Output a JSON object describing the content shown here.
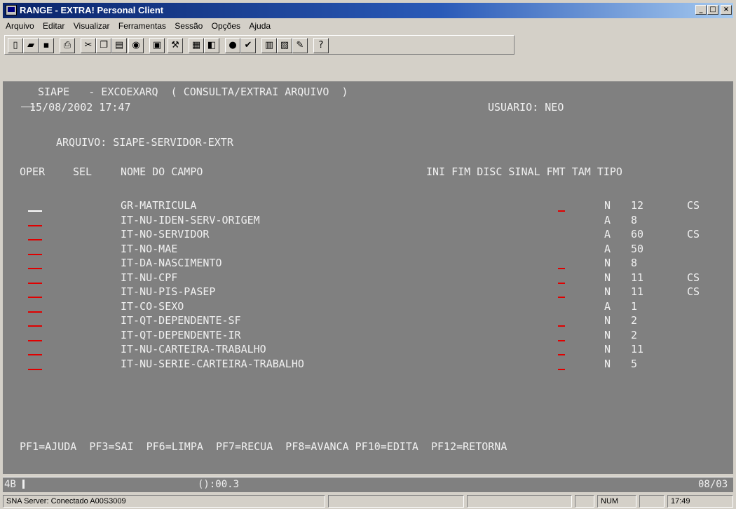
{
  "window": {
    "title": "RANGE - EXTRA! Personal Client"
  },
  "menu": [
    "Arquivo",
    "Editar",
    "Visualizar",
    "Ferramentas",
    "Sessão",
    "Opções",
    "Ajuda"
  ],
  "toolbar_icons": [
    "new-icon",
    "open-icon",
    "save-icon",
    "print-icon",
    "cut-icon",
    "copy-icon",
    "paste-icon",
    "keyboard-icon",
    "transfer-icon",
    "tools-icon",
    "macro-icon",
    "record-icon",
    "play-icon",
    "settings-icon",
    "chart-icon",
    "report-icon",
    "edit-icon",
    "help-icon"
  ],
  "terminal": {
    "header_line1": "SIAPE   - EXCOEXARQ  ( CONSULTA/EXTRAI ARQUIVO  )",
    "datetime": "15/08/2002 17:47",
    "user": "USUARIO: NEO",
    "arquivo": "ARQUIVO: SIAPE-SERVIDOR-EXTR",
    "columns": {
      "oper": "OPER",
      "sel": "SEL",
      "nome": "NOME DO CAMPO",
      "rest": "INI FIM DISC SINAL FMT TAM TIPO"
    },
    "rows": [
      {
        "campo": "GR-MATRICULA",
        "fmt": "N",
        "tam": "12",
        "tipo": "CS",
        "sinal": true
      },
      {
        "campo": "IT-NU-IDEN-SERV-ORIGEM",
        "fmt": "A",
        "tam": "8",
        "tipo": "",
        "sinal": false
      },
      {
        "campo": "IT-NO-SERVIDOR",
        "fmt": "A",
        "tam": "60",
        "tipo": "CS",
        "sinal": false
      },
      {
        "campo": "IT-NO-MAE",
        "fmt": "A",
        "tam": "50",
        "tipo": "",
        "sinal": false
      },
      {
        "campo": "IT-DA-NASCIMENTO",
        "fmt": "N",
        "tam": "8",
        "tipo": "",
        "sinal": true
      },
      {
        "campo": "IT-NU-CPF",
        "fmt": "N",
        "tam": "11",
        "tipo": "CS",
        "sinal": true
      },
      {
        "campo": "IT-NU-PIS-PASEP",
        "fmt": "N",
        "tam": "11",
        "tipo": "CS",
        "sinal": true
      },
      {
        "campo": "IT-CO-SEXO",
        "fmt": "A",
        "tam": "1",
        "tipo": "",
        "sinal": false
      },
      {
        "campo": "IT-QT-DEPENDENTE-SF",
        "fmt": "N",
        "tam": "2",
        "tipo": "",
        "sinal": true
      },
      {
        "campo": "IT-QT-DEPENDENTE-IR",
        "fmt": "N",
        "tam": "2",
        "tipo": "",
        "sinal": true
      },
      {
        "campo": "IT-NU-CARTEIRA-TRABALHO",
        "fmt": "N",
        "tam": "11",
        "tipo": "",
        "sinal": true
      },
      {
        "campo": "IT-NU-SERIE-CARTEIRA-TRABALHO",
        "fmt": "N",
        "tam": "5",
        "tipo": "",
        "sinal": true
      }
    ],
    "function_keys": "PF1=AJUDA  PF3=SAI  PF6=LIMPA  PF7=RECUA  PF8=AVANCA PF10=EDITA  PF12=RETORNA"
  },
  "oia": {
    "session": "4B",
    "timer": "():00.3",
    "cursor": "08/03"
  },
  "status": {
    "connection": "SNA Server: Conectado A00S3009",
    "num": "NUM",
    "time": "17:49"
  },
  "colors": {
    "terminal_bg": "#808080",
    "field_underline": "#e00000",
    "titlebar": "#0a246a"
  }
}
